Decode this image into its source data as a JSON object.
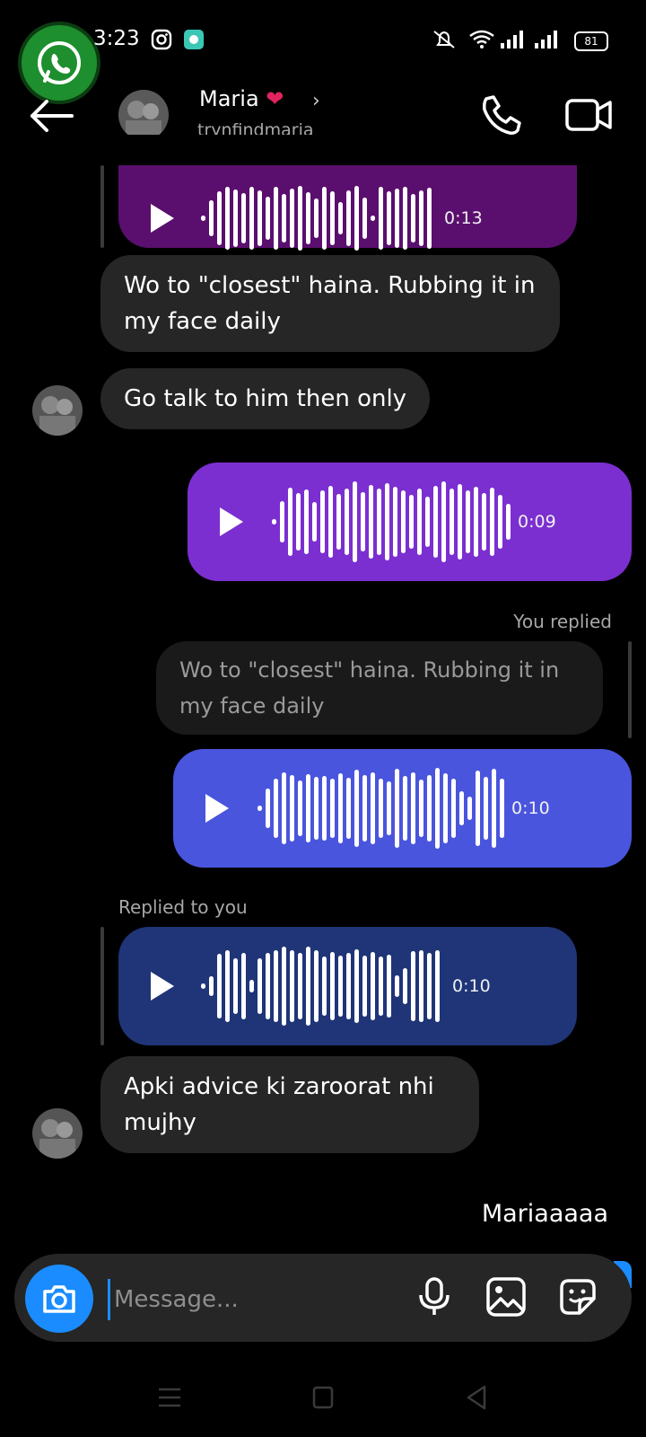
{
  "status": {
    "time": "3:23",
    "battery": "81"
  },
  "header": {
    "name": "Maria",
    "username": "trynfindmaria"
  },
  "messages": {
    "voice1": {
      "duration": "0:13"
    },
    "text1": "Wo to \"closest\" haina. Rubbing it in my face daily",
    "text2": "Go talk to him then only",
    "voice2": {
      "duration": "0:09"
    },
    "you_replied_label": "You replied",
    "quoted": "Wo to \"closest\" haina. Rubbing it in my face daily",
    "voice3": {
      "duration": "0:10"
    },
    "replied_to_you_label": "Replied to you",
    "voice4": {
      "duration": "0:10"
    },
    "text3": "Apki advice ki zaroorat nhi mujhy",
    "outgoing_text": "Mariaaaaa"
  },
  "composer": {
    "placeholder": "Message..."
  },
  "icons": [
    "whatsapp-icon",
    "instagram-icon",
    "app-icon",
    "mute-icon",
    "wifi-icon",
    "signal-icon",
    "battery-icon",
    "back-arrow-icon",
    "phone-icon",
    "video-icon",
    "chevron-right-icon",
    "play-icon",
    "camera-icon",
    "microphone-icon",
    "gallery-icon",
    "sticker-icon",
    "menu-icon",
    "home-icon",
    "back-icon"
  ],
  "colors": {
    "voice1": "#5a0f6e",
    "voice2": "#7b2fd0",
    "voice3": "#4a55dd",
    "voice4": "#1f3578",
    "accent": "#1a8cff",
    "incoming": "#262626"
  }
}
